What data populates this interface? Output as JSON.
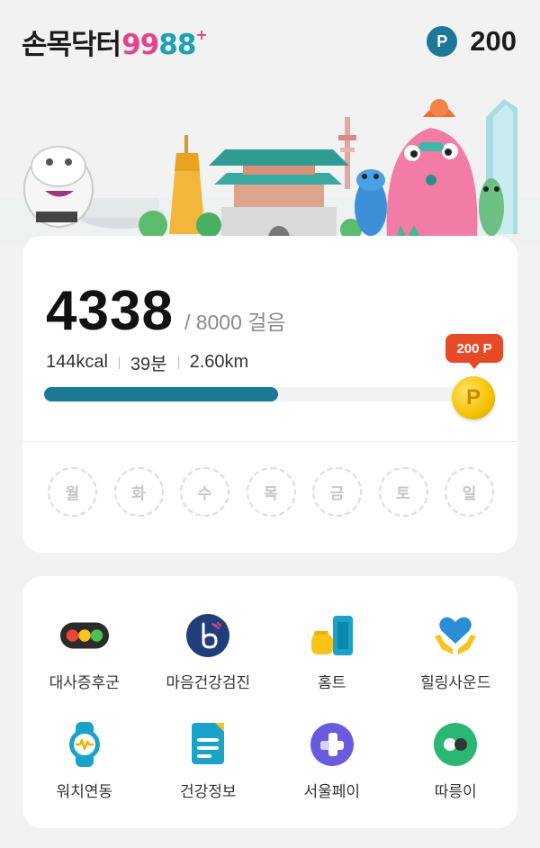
{
  "header": {
    "logo_korean": "손목닥터",
    "logo_digits": [
      "9",
      "9",
      "8",
      "8"
    ],
    "logo_plus": "+",
    "point_icon": "P",
    "point_value": "200"
  },
  "steps_card": {
    "steps": "4338",
    "goal": "/ 8000 걸음",
    "calories": "144kcal",
    "minutes": "39분",
    "distance": "2.60km",
    "progress_fraction": 0.542,
    "reward_badge": "200 P",
    "coin_letter": "P",
    "weekdays": [
      "월",
      "화",
      "수",
      "목",
      "금",
      "토",
      "일"
    ]
  },
  "menu": {
    "items": [
      {
        "label": "대사증후군",
        "icon": "traffic-light-icon"
      },
      {
        "label": "마음건강검진",
        "icon": "mind-b-icon"
      },
      {
        "label": "홈트",
        "icon": "dumbbell-icon"
      },
      {
        "label": "힐링사운드",
        "icon": "heart-hands-icon"
      },
      {
        "label": "워치연동",
        "icon": "smartwatch-icon"
      },
      {
        "label": "건강정보",
        "icon": "document-icon"
      },
      {
        "label": "서울페이",
        "icon": "seoul-pay-icon"
      },
      {
        "label": "따릉이",
        "icon": "bike-toggle-icon"
      }
    ]
  },
  "colors": {
    "brand_teal": "#1b7897",
    "badge_red": "#e84a28",
    "coin_gold": "#f5c000",
    "pink": "#e2458b"
  }
}
